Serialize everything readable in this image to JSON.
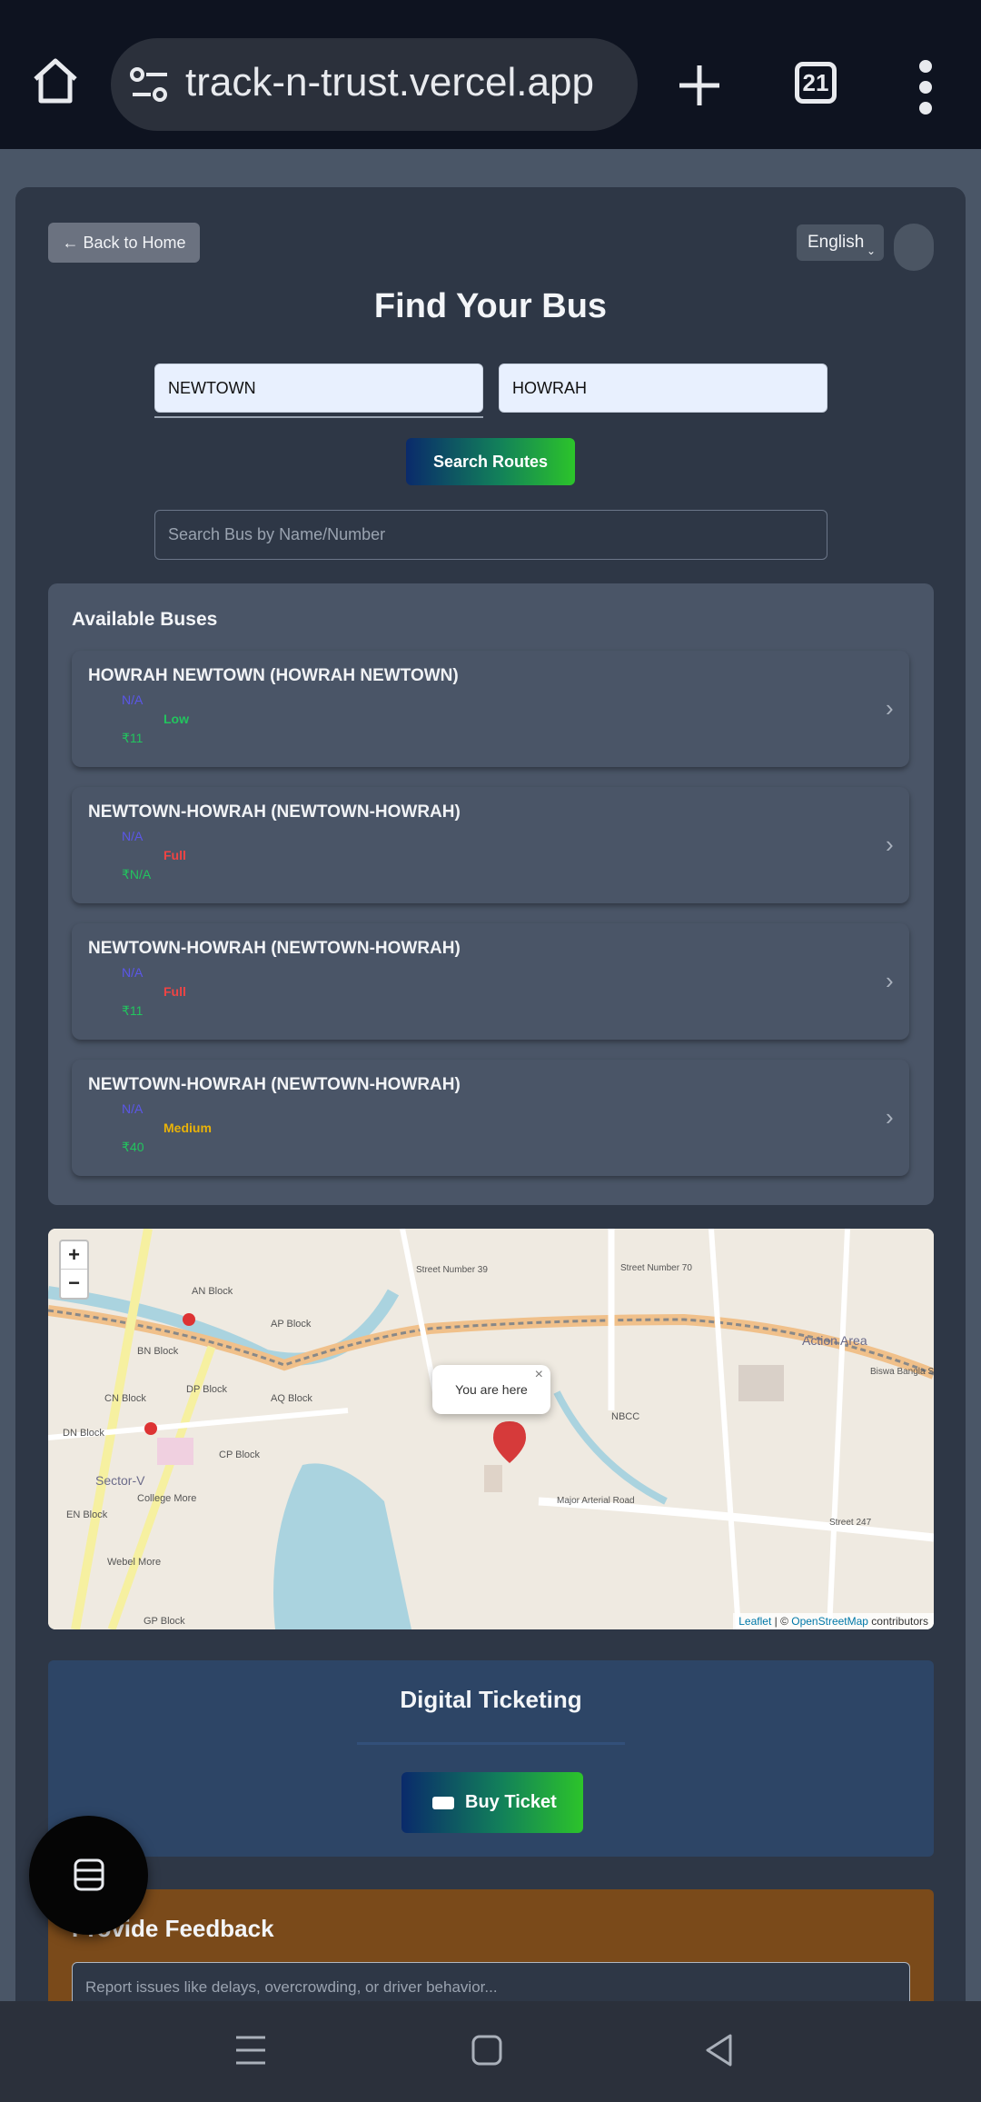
{
  "browser": {
    "url": "track-n-trust.vercel.app",
    "tab_count": "21"
  },
  "header": {
    "back_label": "← Back to Home",
    "language": "English",
    "title": "Find Your Bus"
  },
  "search": {
    "from_value": "NEWTOWN",
    "to_value": "HOWRAH",
    "button_label": "Search Routes",
    "bus_placeholder": "Search Bus by Name/Number"
  },
  "available": {
    "heading": "Available Buses",
    "buses": [
      {
        "name": "HOWRAH NEWTOWN (HOWRAH NEWTOWN)",
        "number": "N/A",
        "crowd": "Low",
        "fare": "₹11"
      },
      {
        "name": "NEWTOWN-HOWRAH (NEWTOWN-HOWRAH)",
        "number": "N/A",
        "crowd": "Full",
        "fare": "₹N/A"
      },
      {
        "name": "NEWTOWN-HOWRAH (NEWTOWN-HOWRAH)",
        "number": "N/A",
        "crowd": "Full",
        "fare": "₹11"
      },
      {
        "name": "NEWTOWN-HOWRAH (NEWTOWN-HOWRAH)",
        "number": "N/A",
        "crowd": "Medium",
        "fare": "₹40"
      }
    ]
  },
  "map": {
    "zoom_in": "+",
    "zoom_out": "−",
    "popup": "You are here",
    "popup_close": "×",
    "attribution_leaflet": "Leaflet",
    "attribution_sep": " | © ",
    "attribution_osm": "OpenStreetMap",
    "attribution_tail": " contributors",
    "labels": {
      "an_block": "AN Block",
      "ap_block": "AP Block",
      "bn_block": "BN Block",
      "cn_block": "CN Block",
      "dp_block": "DP Block",
      "aq_block": "AQ Block",
      "dn_block": "DN Block",
      "cp_block": "CP Block",
      "sector_v": "Sector-V",
      "college_more": "College More",
      "en_block": "EN Block",
      "webel_more": "Webel More",
      "gp_block": "GP Block",
      "nbcc": "NBCC",
      "action_area": "Action Area",
      "arterial_road": "Major Arterial Road",
      "street_247": "Street 247",
      "street_70": "Street Number 70",
      "street_39": "Street Number 39",
      "biswa_bangla": "Biswa Bangla Sar"
    }
  },
  "ticket": {
    "heading": "Digital Ticketing",
    "button_label": "Buy Ticket"
  },
  "feedback": {
    "heading": "Provide Feedback",
    "placeholder": "Report issues like delays, overcrowding, or driver behavior..."
  },
  "colors": {
    "crowd_low": "#22c55e",
    "crowd_full": "#ef4444",
    "crowd_medium": "#eab308",
    "bus_number": "#5b57e8",
    "fare": "#22c55e"
  }
}
